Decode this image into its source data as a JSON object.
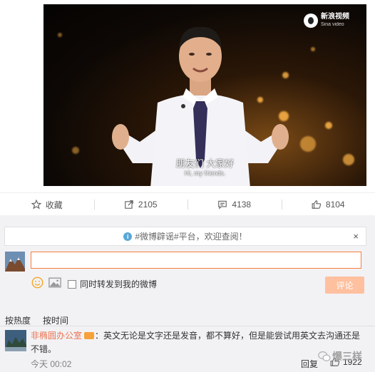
{
  "video": {
    "brand_cn": "新浪视频",
    "brand_en": "Sina video",
    "subtitle_cn": "朋友们 大家好",
    "subtitle_en": "Hi, my friends."
  },
  "actions": {
    "favorite": "收藏",
    "repost_count": "2105",
    "comment_count": "4138",
    "like_count": "8104"
  },
  "notice": {
    "text": "#微博辟谣#平台，欢迎查阅！",
    "close": "×"
  },
  "composer": {
    "input_value": "",
    "repost_label": "同时转发到我的微博",
    "submit_label": "评论"
  },
  "sort": {
    "hot": "按热度",
    "time": "按时间"
  },
  "comment": {
    "user": "非椭圆办公室",
    "text": "：英文无论是文字还是发音，都不算好，但是能尝试用英文去沟通还是不错。",
    "time": "今天 00:02",
    "reply": "回复",
    "likes": "1922"
  },
  "watermark": {
    "text": "爆三样"
  },
  "colors": {
    "accent": "#eb7350",
    "input_border": "#fa7d3c",
    "submit_disabled": "#ffc09f",
    "panel_bg": "#f2f2f5"
  },
  "icons": [
    "star-icon",
    "repost-icon",
    "comment-icon",
    "thumbs-up-icon",
    "info-icon",
    "close-icon",
    "emoji-icon",
    "picture-icon",
    "sina-video-logo",
    "wechat-icon"
  ]
}
